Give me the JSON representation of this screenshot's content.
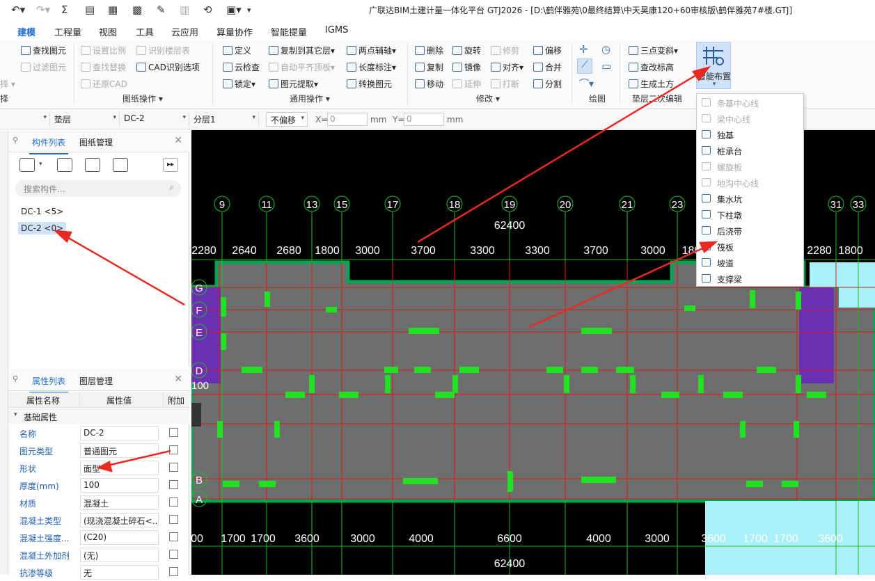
{
  "title": "广联达BIM土建计量一体化平台 GTJ2026 - [D:\\鹤伴雅苑\\0最终结算\\中天昊康120+60审核版\\鹤伴雅苑7#楼.GTJ]",
  "menu_tabs": [
    "建模",
    "工程量",
    "视图",
    "工具",
    "云应用",
    "算量协作",
    "智能提量",
    "IGMS"
  ],
  "ribbon": {
    "left_cut": {
      "find": "查找图元",
      "filter": "过滤图元",
      "select": "择"
    },
    "drawing": {
      "set_scale": "设置比例",
      "identify_floor": "识别楼层表",
      "find_replace": "查找替换",
      "cad_options": "CAD识别选项",
      "restore_cad": "还原CAD",
      "group": "图纸操作"
    },
    "common": {
      "define": "定义",
      "copy_to_other": "复制到其它层",
      "two_point_axis": "两点辅轴",
      "cloud_check": "云检查",
      "auto_flat": "自动平齐顶板",
      "length_dim": "长度标注",
      "lock": "锁定",
      "extract": "图元提取",
      "convert": "转换图元",
      "group": "通用操作"
    },
    "modify": {
      "delete": "删除",
      "rotate": "旋转",
      "trim": "修剪",
      "offset": "偏移",
      "copy": "复制",
      "mirror": "镜像",
      "align": "对齐",
      "merge": "合并",
      "move": "移动",
      "extend": "延伸",
      "break": "打断",
      "split": "分割",
      "group": "修改"
    },
    "draw_group": "绘图",
    "secondary": {
      "three_point_slope": "三点变斜",
      "change_elev": "查改标高",
      "gen_earth": "生成土方",
      "group": "垫层二次编辑"
    },
    "smart_place": "智能布置"
  },
  "toolbar2": {
    "cat": "垫层",
    "name": "DC-2",
    "layer": "分层1",
    "offset": "不偏移",
    "x_label": "X=",
    "x_val": "0",
    "y_label": "Y=",
    "y_val": "0",
    "unit": "mm"
  },
  "component_panel": {
    "tabs": [
      "构件列表",
      "图纸管理"
    ],
    "search_placeholder": "搜索构件...",
    "items": [
      "DC-1 <5>",
      "DC-2 <0>"
    ]
  },
  "property_panel": {
    "tabs": [
      "属性列表",
      "图层管理"
    ],
    "headers": [
      "属性名称",
      "属性值",
      "附加"
    ],
    "section": "基础属性",
    "rows": [
      {
        "key": "名称",
        "value": "DC-2"
      },
      {
        "key": "图元类型",
        "value": "普通图元"
      },
      {
        "key": "形状",
        "value": "面型"
      },
      {
        "key": "厚度(mm)",
        "value": "100"
      },
      {
        "key": "材质",
        "value": "混凝土"
      },
      {
        "key": "混凝土类型",
        "value": "(现浇混凝土碎石<..."
      },
      {
        "key": "混凝土强度...",
        "value": "(C20)"
      },
      {
        "key": "混凝土外加剂",
        "value": "(无)"
      },
      {
        "key": "抗渗等级",
        "value": "无"
      }
    ]
  },
  "dropdown": {
    "items": [
      {
        "label": "条基中心线",
        "enabled": false
      },
      {
        "label": "梁中心线",
        "enabled": false
      },
      {
        "label": "独基",
        "enabled": true
      },
      {
        "label": "桩承台",
        "enabled": true
      },
      {
        "label": "螺旋板",
        "enabled": false
      },
      {
        "label": "地沟中心线",
        "enabled": false
      },
      {
        "label": "集水坑",
        "enabled": true
      },
      {
        "label": "下柱墩",
        "enabled": true
      },
      {
        "label": "后浇带",
        "enabled": true
      },
      {
        "label": "筏板",
        "enabled": true
      },
      {
        "label": "坡道",
        "enabled": true
      },
      {
        "label": "支撑梁",
        "enabled": true
      }
    ]
  },
  "canvas": {
    "axis_top": [
      "9",
      "11",
      "13",
      "15",
      "17",
      "18",
      "19",
      "20",
      "21",
      "23",
      "31",
      "33"
    ],
    "axis_left": [
      "G",
      "F",
      "E",
      "D",
      "B",
      "A"
    ],
    "total_dim": "62400",
    "top_dims": [
      "2280",
      "2640",
      "2680",
      "1800",
      "3000",
      "3700",
      "3300",
      "3300",
      "3700",
      "3000",
      "180",
      "2280",
      "1800"
    ],
    "bottom_dims": [
      "00",
      "1700",
      "1700",
      "3600",
      "3000",
      "4000",
      "6600",
      "4000",
      "3000",
      "3600",
      "1700",
      "1700",
      "3600"
    ],
    "left_label": "100",
    "colors": {
      "slab": "#6e6e6e",
      "wall": "#00a652",
      "grid": "#e0161b",
      "column": "#22e022",
      "purple": "#6b2fb3",
      "cyan": "#aaf0f8"
    }
  }
}
